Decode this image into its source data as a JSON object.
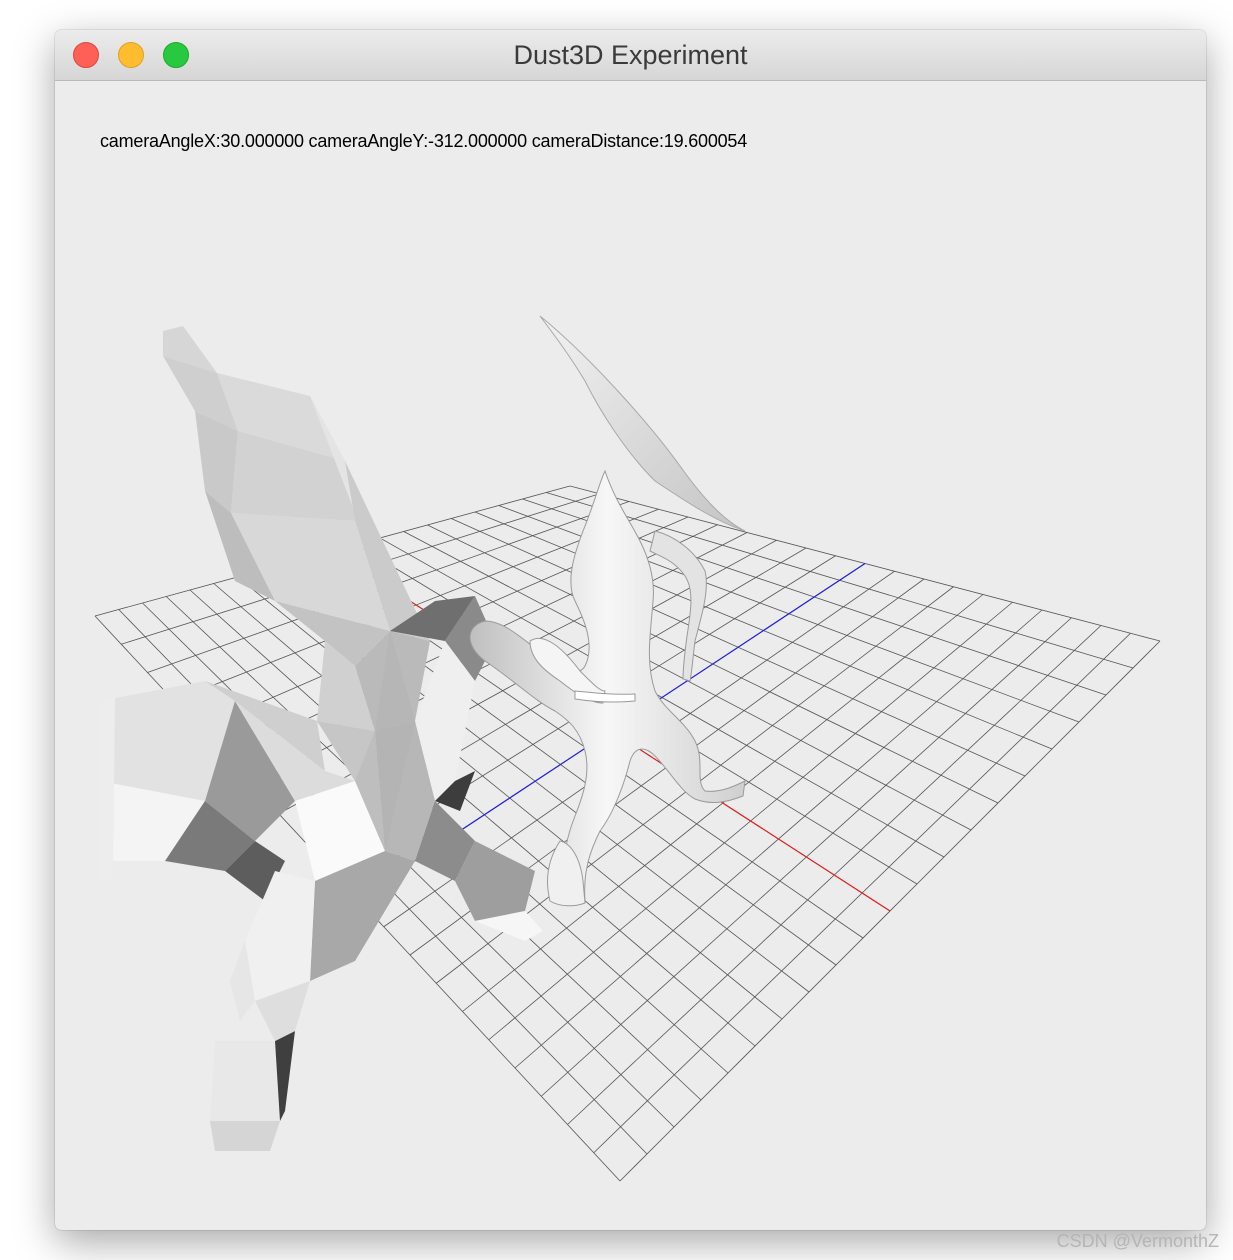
{
  "window": {
    "title": "Dust3D Experiment"
  },
  "camera_info": "cameraAngleX:30.000000 cameraAngleY:-312.000000 cameraDistance:19.600054",
  "scene": {
    "grid_color": "#555555",
    "x_axis_color": "#e02020",
    "z_axis_color": "#2020e0",
    "background_color": "#ececec",
    "objects": [
      "low-poly-model",
      "smooth-model"
    ]
  },
  "watermark": "CSDN @VermonthZ",
  "icons": {
    "close": "close-button-icon",
    "minimize": "minimize-button-icon",
    "zoom": "zoom-button-icon"
  }
}
